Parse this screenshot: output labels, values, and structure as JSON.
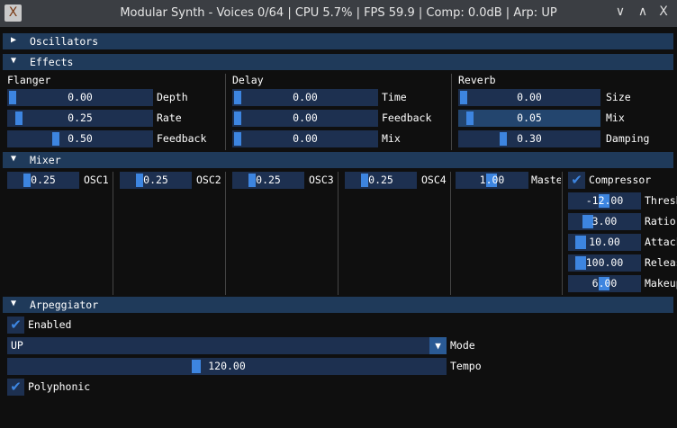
{
  "window": {
    "title": "Modular Synth - Voices 0/64 | CPU 5.7% | FPS 59.9 | Comp: 0.0dB | Arp: UP",
    "icons": [
      "app-icon",
      "minimize-icon",
      "maximize-icon",
      "close-icon"
    ],
    "min": "∨",
    "max": "∧",
    "close": "X"
  },
  "oscillators": {
    "label": "Oscillators",
    "arrow": "▶"
  },
  "effects": {
    "label": "Effects",
    "arrow": "▼",
    "flanger": {
      "title": "Flanger",
      "depth": {
        "label": "Depth",
        "value": "0.00"
      },
      "rate": {
        "label": "Rate",
        "value": "0.25"
      },
      "feedback": {
        "label": "Feedback",
        "value": "0.50"
      }
    },
    "delay": {
      "title": "Delay",
      "time": {
        "label": "Time",
        "value": "0.00"
      },
      "feedback": {
        "label": "Feedback",
        "value": "0.00"
      },
      "mix": {
        "label": "Mix",
        "value": "0.00"
      }
    },
    "reverb": {
      "title": "Reverb",
      "size": {
        "label": "Size",
        "value": "0.00"
      },
      "mix": {
        "label": "Mix",
        "value": "0.05"
      },
      "damping": {
        "label": "Damping",
        "value": "0.30"
      }
    }
  },
  "mixer": {
    "label": "Mixer",
    "arrow": "▼",
    "osc1": {
      "label": "OSC1",
      "value": "0.25"
    },
    "osc2": {
      "label": "OSC2",
      "value": "0.25"
    },
    "osc3": {
      "label": "OSC3",
      "value": "0.25"
    },
    "osc4": {
      "label": "OSC4",
      "value": "0.25"
    },
    "master": {
      "label": "Master",
      "value": "1.00"
    },
    "compressor": {
      "label": "Compressor",
      "checked": true,
      "check": "✔",
      "threshold": {
        "label": "Threshold",
        "value": "-12.00"
      },
      "ratio": {
        "label": "Ratio",
        "value": "3.00"
      },
      "attack": {
        "label": "Attack",
        "value": "10.00"
      },
      "release": {
        "label": "Release",
        "value": "100.00"
      },
      "makeup": {
        "label": "Makeup",
        "value": "6.00"
      }
    }
  },
  "arpeggiator": {
    "label": "Arpeggiator",
    "arrow": "▼",
    "enabled": {
      "label": "Enabled",
      "checked": true
    },
    "mode": {
      "label": "Mode",
      "value": "UP",
      "arrow": "▼"
    },
    "tempo": {
      "label": "Tempo",
      "value": "120.00"
    },
    "polyphonic": {
      "label": "Polyphonic",
      "checked": true
    },
    "check": "✔"
  }
}
